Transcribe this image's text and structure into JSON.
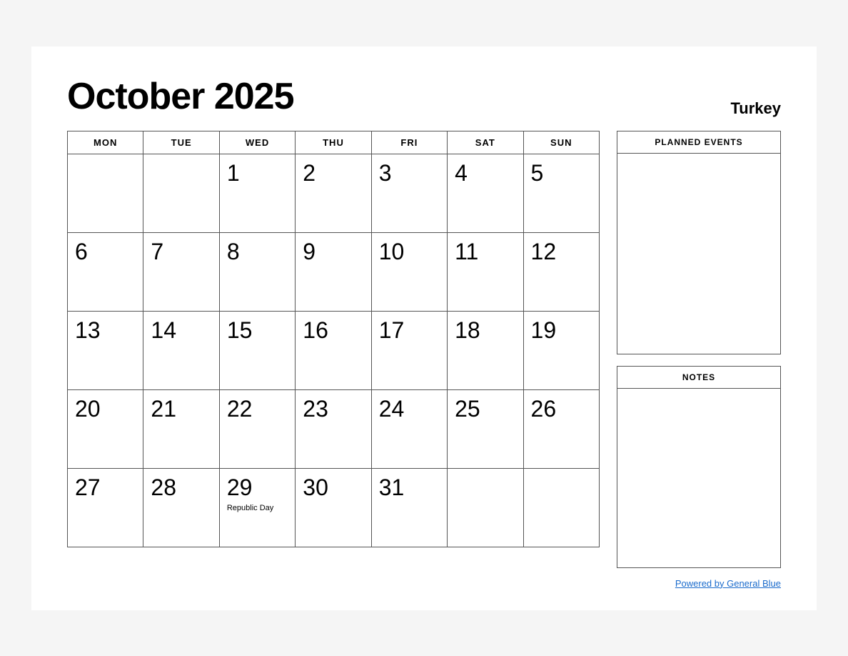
{
  "header": {
    "title": "October 2025",
    "country": "Turkey"
  },
  "calendar": {
    "days_of_week": [
      "MON",
      "TUE",
      "WED",
      "THU",
      "FRI",
      "SAT",
      "SUN"
    ],
    "weeks": [
      [
        {
          "day": "",
          "holiday": ""
        },
        {
          "day": "",
          "holiday": ""
        },
        {
          "day": "1",
          "holiday": ""
        },
        {
          "day": "2",
          "holiday": ""
        },
        {
          "day": "3",
          "holiday": ""
        },
        {
          "day": "4",
          "holiday": ""
        },
        {
          "day": "5",
          "holiday": ""
        }
      ],
      [
        {
          "day": "6",
          "holiday": ""
        },
        {
          "day": "7",
          "holiday": ""
        },
        {
          "day": "8",
          "holiday": ""
        },
        {
          "day": "9",
          "holiday": ""
        },
        {
          "day": "10",
          "holiday": ""
        },
        {
          "day": "11",
          "holiday": ""
        },
        {
          "day": "12",
          "holiday": ""
        }
      ],
      [
        {
          "day": "13",
          "holiday": ""
        },
        {
          "day": "14",
          "holiday": ""
        },
        {
          "day": "15",
          "holiday": ""
        },
        {
          "day": "16",
          "holiday": ""
        },
        {
          "day": "17",
          "holiday": ""
        },
        {
          "day": "18",
          "holiday": ""
        },
        {
          "day": "19",
          "holiday": ""
        }
      ],
      [
        {
          "day": "20",
          "holiday": ""
        },
        {
          "day": "21",
          "holiday": ""
        },
        {
          "day": "22",
          "holiday": ""
        },
        {
          "day": "23",
          "holiday": ""
        },
        {
          "day": "24",
          "holiday": ""
        },
        {
          "day": "25",
          "holiday": ""
        },
        {
          "day": "26",
          "holiday": ""
        }
      ],
      [
        {
          "day": "27",
          "holiday": ""
        },
        {
          "day": "28",
          "holiday": ""
        },
        {
          "day": "29",
          "holiday": "Republic Day"
        },
        {
          "day": "30",
          "holiday": ""
        },
        {
          "day": "31",
          "holiday": ""
        },
        {
          "day": "",
          "holiday": ""
        },
        {
          "day": "",
          "holiday": ""
        }
      ]
    ]
  },
  "sidebar": {
    "planned_events_label": "PLANNED EVENTS",
    "notes_label": "NOTES"
  },
  "footer": {
    "powered_by": "Powered by General Blue",
    "link_url": "#"
  }
}
